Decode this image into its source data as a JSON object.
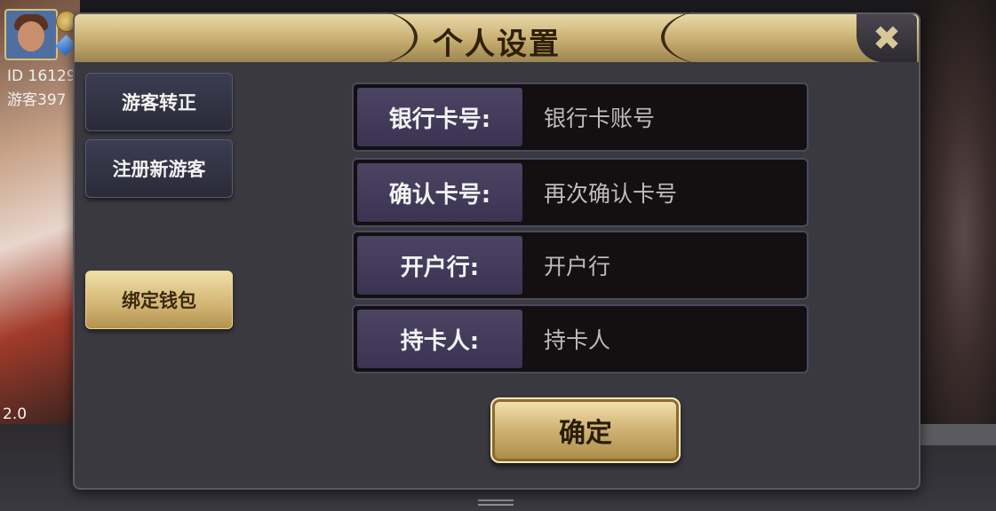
{
  "background": {
    "user_id": "ID 16129",
    "user_name": "游客397",
    "version": "2.0"
  },
  "dialog": {
    "title": "个人设置",
    "close_icon": "close-icon"
  },
  "nav": {
    "items": [
      {
        "label": "游客转正",
        "active": false
      },
      {
        "label": "注册新游客",
        "active": false
      },
      {
        "label": "绑定钱包",
        "active": true
      }
    ]
  },
  "form": {
    "fields": [
      {
        "label": "银行卡号:",
        "placeholder": "银行卡账号",
        "value": ""
      },
      {
        "label": "确认卡号:",
        "placeholder": "再次确认卡号",
        "value": ""
      },
      {
        "label": "开户行:",
        "placeholder": "开户行",
        "value": ""
      },
      {
        "label": "持卡人:",
        "placeholder": "持卡人",
        "value": ""
      }
    ],
    "confirm_label": "确定"
  },
  "colors": {
    "accent_gold": "#d3b678",
    "panel": "#3a3940",
    "field_label_bg": "#4b4462"
  }
}
